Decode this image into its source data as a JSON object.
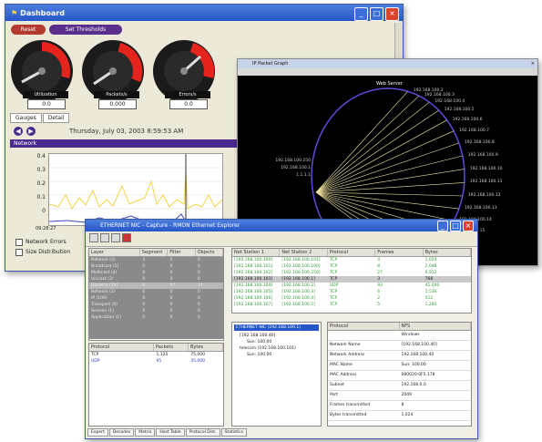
{
  "dashboard": {
    "title": "Dashboard",
    "reset_label": "Reset",
    "thresholds_label": "Set Thresholds",
    "gauges": [
      {
        "label": "Utilization",
        "value": "0.0"
      },
      {
        "label": "Packets/s",
        "value": "0.000"
      },
      {
        "label": "Errors/s",
        "value": "0.0"
      }
    ],
    "gauge_tabs": [
      "Gauges",
      "Detail"
    ],
    "datetime": "Thursday, July 03, 2003 8:59:53 AM",
    "network_section": "Network",
    "y_ticks": [
      "0.4",
      "0.3",
      "0.2",
      "0.1",
      "0"
    ],
    "x_start_label": "09:28:27",
    "legend": [
      "Network Errors",
      "Size Distribution"
    ],
    "colors": {
      "yellow_series": "#f2d34a",
      "blue_series": "#3a46c0",
      "red_zone": "#e4241d"
    }
  },
  "dark_window": {
    "title": "IP Packet Graph",
    "center_label": "Web Server",
    "left_labels": [
      "192.168.100.250",
      "192.168.100.1",
      "1.1.1.1"
    ],
    "right_labels": [
      "192.168.100.2",
      "192.168.100.3",
      "192.168.100.4",
      "192.168.100.5",
      "192.168.100.6",
      "192.168.100.7",
      "192.168.100.8",
      "192.168.100.9",
      "192.168.100.10",
      "192.168.100.11",
      "192.168.100.12",
      "192.168.100.13",
      "192.168.100.14",
      "192.168.100.15",
      "192.168.100.16",
      "192.168.100.17",
      "192.168.100.18",
      "192.168.100.19"
    ]
  },
  "explorer": {
    "title": "ETHERNET NIC - Capture - RMON Ethernet Explorer",
    "left_table": {
      "headers": [
        "Layer",
        "Segment",
        "Filter",
        "Objects"
      ],
      "rows": [
        {
          "layer": "Network (2)",
          "segment": "4",
          "filter": "0",
          "objects": "0"
        },
        {
          "layer": "Broadcast (2)",
          "segment": "0",
          "filter": "0",
          "objects": "0"
        },
        {
          "layer": "Multicast (4)",
          "segment": "0",
          "filter": "0",
          "objects": "0"
        },
        {
          "layer": "Unicast (2)",
          "segment": "0",
          "filter": "0",
          "objects": "0"
        },
        {
          "layer": "Datalink (23)",
          "segment": "6",
          "filter": "97",
          "objects": "23"
        },
        {
          "layer": "Network (2)",
          "segment": "0",
          "filter": "0",
          "objects": "0"
        },
        {
          "layer": "IP (100)",
          "segment": "0",
          "filter": "0",
          "objects": "0"
        },
        {
          "layer": "Transport (4)",
          "segment": "0",
          "filter": "0",
          "objects": "0"
        },
        {
          "layer": "Session (1)",
          "segment": "0",
          "filter": "0",
          "objects": "0"
        },
        {
          "layer": "Application (1)",
          "segment": "0",
          "filter": "0",
          "objects": "0"
        }
      ]
    },
    "proto_table": {
      "headers": [
        "Protocol",
        "Packets",
        "Bytes"
      ],
      "rows": [
        {
          "protocol": "TCP",
          "packets": "1,125",
          "bytes": "75,000"
        },
        {
          "protocol": "UDP",
          "packets": "95",
          "bytes": "45,000"
        }
      ]
    },
    "conv_table": {
      "headers": [
        "Net Station 1",
        "Net Station 2",
        "Protocol",
        "Frames",
        "Bytes"
      ],
      "rows": [
        {
          "s1": "[192.168.100.100]",
          "s2": "[192.168.100.101]",
          "proto": "TCP",
          "frames": "4",
          "bytes": "1,024"
        },
        {
          "s1": "[192.168.100.101]",
          "s2": "[192.168.100.100]",
          "proto": "TCP",
          "frames": "8",
          "bytes": "2,048"
        },
        {
          "s1": "[192.168.100.102]",
          "s2": "[192.168.100.250]",
          "proto": "TCP",
          "frames": "27",
          "bytes": "6,912"
        },
        {
          "s1": "[192.168.100.103]",
          "s2": "[192.168.100.1]",
          "proto": "TCP",
          "frames": "3",
          "bytes": "768"
        },
        {
          "s1": "[192.168.100.104]",
          "s2": "[192.168.100.2]",
          "proto": "UDP",
          "frames": "93",
          "bytes": "41,000"
        },
        {
          "s1": "[192.168.100.105]",
          "s2": "[192.168.100.3]",
          "proto": "TCP",
          "frames": "6",
          "bytes": "1,536"
        },
        {
          "s1": "[192.168.100.106]",
          "s2": "[192.168.100.4]",
          "proto": "TCP",
          "frames": "2",
          "bytes": "512"
        },
        {
          "s1": "[192.168.100.107]",
          "s2": "[192.168.100.5]",
          "proto": "TCP",
          "frames": "5",
          "bytes": "1,280"
        }
      ]
    },
    "tree": [
      "ETHERNET NIC (192.168.100.1)",
      "[192.168.100.40]",
      "Sun: 100.00",
      "telecom (192.168.100.101)",
      "Sun: 100.00"
    ],
    "props": {
      "headers": [
        "Protocol",
        "NFS"
      ],
      "rows": [
        {
          "k": "",
          "v": "Windows"
        },
        {
          "k": "Network Name",
          "v": "[192.168.100.40]"
        },
        {
          "k": "Network Address",
          "v": "192.168.100.40"
        },
        {
          "k": "MAC Name",
          "v": "Sun: 100.00"
        },
        {
          "k": "MAC Address",
          "v": "080020:0F5.178"
        },
        {
          "k": "Subnet",
          "v": "192.168.0.0"
        },
        {
          "k": "Port",
          "v": "2049"
        },
        {
          "k": "Frames transmitted",
          "v": "8"
        },
        {
          "k": "Bytes transmitted",
          "v": "1,024"
        }
      ]
    },
    "bottom_tabs": [
      "Expert",
      "Decodes",
      "Matrix",
      "Host Table",
      "Protocol Dist.",
      "Statistics"
    ]
  }
}
